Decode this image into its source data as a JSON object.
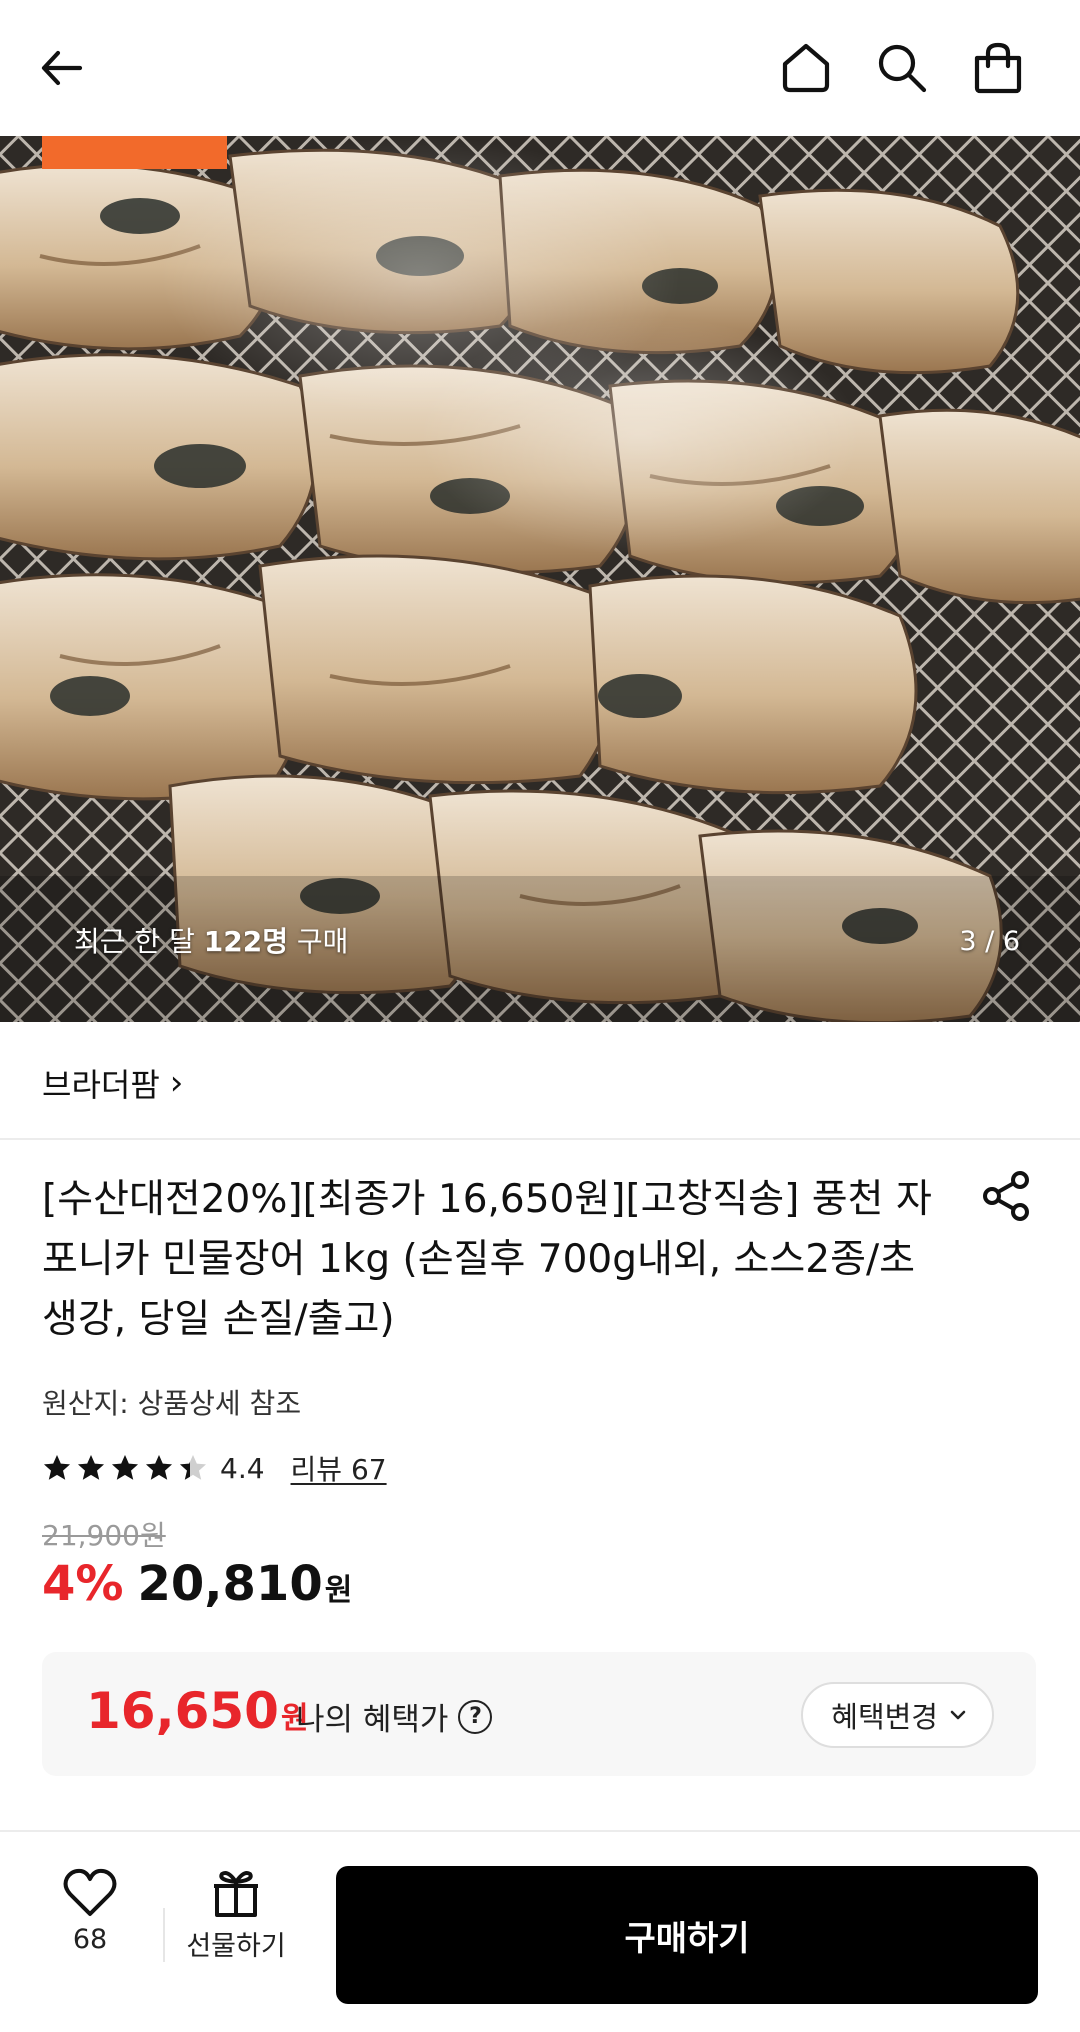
{
  "hero": {
    "recent_prefix": "최근 한 달 ",
    "recent_count": "122명",
    "recent_suffix": " 구매",
    "counter": "3 / 6"
  },
  "brand": {
    "name": "브라더팜",
    "chevron": "›"
  },
  "product": {
    "title": "[수산대전20%][최종가 16,650원][고창직송] 풍천 자포니카 민물장어 1kg (손질후 700g내외, 소스2종/초생강, 당일 손질/출고)",
    "origin": "원산지: 상품상세 참조",
    "rating": "4.4",
    "rating_value": 4.4,
    "review_link": "리뷰 67",
    "original_price": "21,900원",
    "discount": "4%",
    "price": "20,810",
    "price_unit": "원"
  },
  "benefit": {
    "price": "16,650",
    "unit": "원",
    "label": "나의 혜택가",
    "help_glyph": "?",
    "change_button": "혜택변경"
  },
  "bottom": {
    "wish_count": "68",
    "gift_label": "선물하기",
    "buy_label": "구매하기"
  },
  "colors": {
    "accent_red": "#e8262b",
    "tag_orange": "#f26a2b",
    "buy_button": "#000000"
  },
  "icons": [
    "back-arrow-icon",
    "home-icon",
    "search-icon",
    "cart-bag-icon",
    "share-icon",
    "star-icon",
    "help-icon",
    "chevron-down-icon",
    "heart-icon",
    "gift-icon"
  ]
}
